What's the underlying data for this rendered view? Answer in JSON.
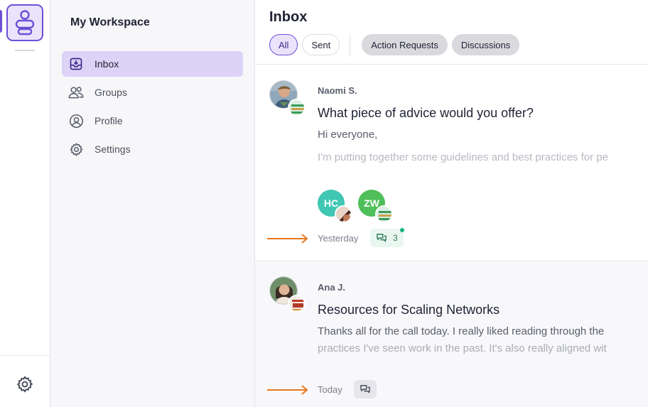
{
  "sidebar": {
    "workspace_title": "My Workspace",
    "items": [
      {
        "label": "Inbox",
        "icon": "inbox-icon",
        "active": true
      },
      {
        "label": "Groups",
        "icon": "groups-icon",
        "active": false
      },
      {
        "label": "Profile",
        "icon": "profile-icon",
        "active": false
      },
      {
        "label": "Settings",
        "icon": "gear-icon",
        "active": false
      }
    ]
  },
  "main": {
    "title": "Inbox",
    "filters": [
      {
        "label": "All",
        "active": true
      },
      {
        "label": "Sent",
        "active": false
      }
    ],
    "type_filters": [
      {
        "label": "Action Requests"
      },
      {
        "label": "Discussions"
      }
    ],
    "threads": [
      {
        "author": "Naomi S.",
        "subject": "What piece of advice would you offer?",
        "line1": "Hi everyone,",
        "line2": "I'm putting together some guidelines and best practices for pe",
        "participants": [
          {
            "initials": "HC",
            "color": "#3fc7b3"
          },
          {
            "initials": "ZW",
            "color": "#4fbf5a"
          }
        ],
        "time": "Yesterday",
        "reply_count": "3",
        "unread": true
      },
      {
        "author": "Ana J.",
        "subject": "Resources for Scaling Networks",
        "line1": "Thanks all for the call today. I really liked reading through the",
        "line2": "practices I've seen work in the past. It's also really aligned wit",
        "time": "Today"
      }
    ]
  },
  "colors": {
    "accent": "#6d4fd6",
    "accent_soft": "#e9e3fb",
    "arrow": "#e8781f",
    "reply_green": "#2f7a5c"
  }
}
